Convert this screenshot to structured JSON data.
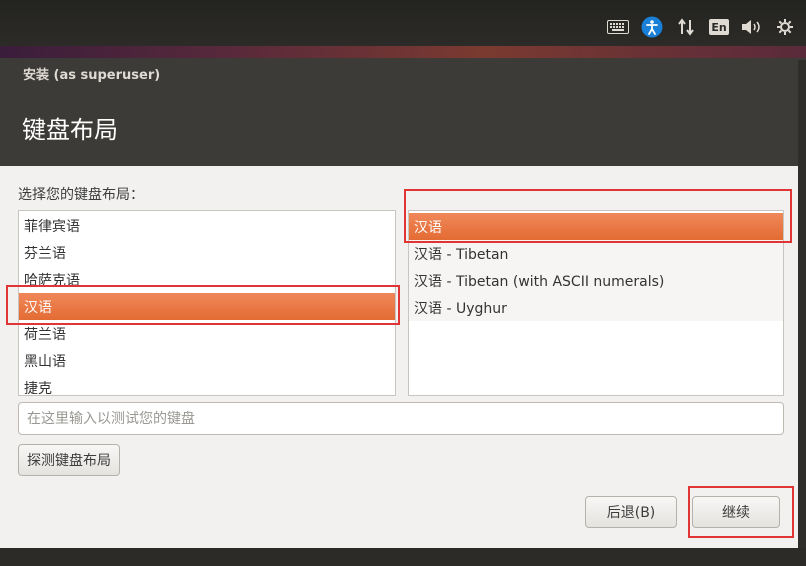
{
  "window": {
    "title": "安装 (as superuser)",
    "page_title": "键盘布局"
  },
  "tray": {
    "keyboard_icon": "keyboard-icon",
    "accessibility_icon": "accessibility-icon",
    "network_icon": "network-icon",
    "language_label": "En",
    "volume_icon": "volume-icon",
    "power_icon": "power-icon"
  },
  "content": {
    "prompt": "选择您的键盘布局：",
    "languages": [
      "菲律宾语",
      "芬兰语",
      "哈萨克语",
      "汉语",
      "荷兰语",
      "黑山语",
      "捷克"
    ],
    "languages_selected": "汉语",
    "variants": [
      "汉语",
      "汉语 - Tibetan",
      "汉语 - Tibetan (with ASCII numerals)",
      "汉语 - Uyghur"
    ],
    "variants_selected": "汉语",
    "test_placeholder": "在这里输入以测试您的键盘",
    "test_value": ""
  },
  "buttons": {
    "detect": "探测键盘布局",
    "back": "后退(B)",
    "continue": "继续"
  },
  "colors": {
    "selection": "#e36b33",
    "highlight": "#e03535",
    "header": "#3c3b37"
  }
}
